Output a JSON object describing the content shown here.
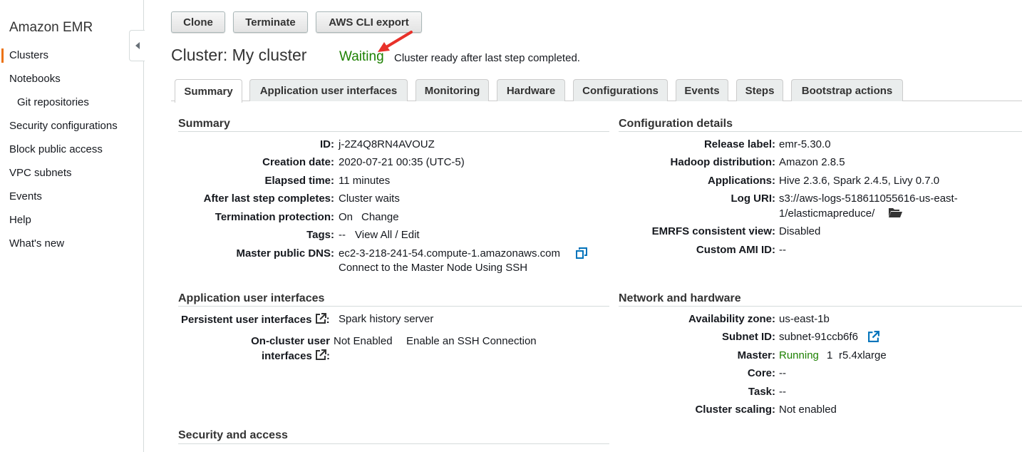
{
  "sidebar": {
    "title": "Amazon EMR",
    "items": [
      {
        "label": "Clusters",
        "active": true
      },
      {
        "label": "Notebooks"
      },
      {
        "label": "Git repositories",
        "sub": true
      },
      {
        "label": "Security configurations"
      },
      {
        "label": "Block public access"
      },
      {
        "label": "VPC subnets"
      },
      {
        "label": "Events"
      },
      {
        "label": "Help"
      },
      {
        "label": "What's new"
      }
    ]
  },
  "toolbar": {
    "clone": "Clone",
    "terminate": "Terminate",
    "cli_export": "AWS CLI export"
  },
  "header": {
    "title": "Cluster: My cluster",
    "status": "Waiting",
    "status_description": "Cluster ready after last step completed."
  },
  "tabs": [
    "Summary",
    "Application user interfaces",
    "Monitoring",
    "Hardware",
    "Configurations",
    "Events",
    "Steps",
    "Bootstrap actions"
  ],
  "summary": {
    "title": "Summary",
    "id_label": "ID:",
    "id": "j-2Z4Q8RN4AVOUZ",
    "creation_label": "Creation date:",
    "creation": "2020-07-21 00:35 (UTC-5)",
    "elapsed_label": "Elapsed time:",
    "elapsed": "11 minutes",
    "after_label": "After last step completes:",
    "after": "Cluster waits",
    "termination_label": "Termination protection:",
    "termination": "On",
    "termination_link": "Change",
    "tags_label": "Tags:",
    "tags": "--",
    "tags_link": "View All / Edit",
    "dns_label": "Master public DNS:",
    "dns": "ec2-3-218-241-54.compute-1.amazonaws.com",
    "ssh_link": "Connect to the Master Node Using SSH"
  },
  "config": {
    "title": "Configuration details",
    "release_label": "Release label:",
    "release": "emr-5.30.0",
    "hadoop_label": "Hadoop distribution:",
    "hadoop": "Amazon 2.8.5",
    "apps_label": "Applications:",
    "apps": "Hive 2.3.6, Spark 2.4.5, Livy 0.7.0",
    "log_label": "Log URI:",
    "log_line1": "s3://aws-logs-518611055616-us-east-",
    "log_line2": "1/elasticmapreduce/",
    "emrfs_label": "EMRFS consistent view:",
    "emrfs": "Disabled",
    "ami_label": "Custom AMI ID:",
    "ami": "--"
  },
  "app_ui": {
    "title": "Application user interfaces",
    "persistent_label": "Persistent user interfaces",
    "persistent_link": "Spark history server",
    "oncluster_label_1": "On-cluster user",
    "oncluster_label_2": "interfaces",
    "oncluster_value": "Not Enabled",
    "oncluster_link": "Enable an SSH Connection",
    "colon": ":"
  },
  "network": {
    "title": "Network and hardware",
    "az_label": "Availability zone:",
    "az": "us-east-1b",
    "subnet_label": "Subnet ID:",
    "subnet": "subnet-91ccb6f6",
    "master_label": "Master:",
    "master_status": "Running",
    "master_count": "1",
    "master_type": "r5.4xlarge",
    "core_label": "Core:",
    "core": "--",
    "task_label": "Task:",
    "task": "--",
    "scaling_label": "Cluster scaling:",
    "scaling": "Not enabled"
  },
  "security": {
    "title": "Security and access"
  },
  "colors": {
    "accent": "#ec7211",
    "link": "#0073bb",
    "success": "#1d8102",
    "arrow": "#e8312a"
  }
}
